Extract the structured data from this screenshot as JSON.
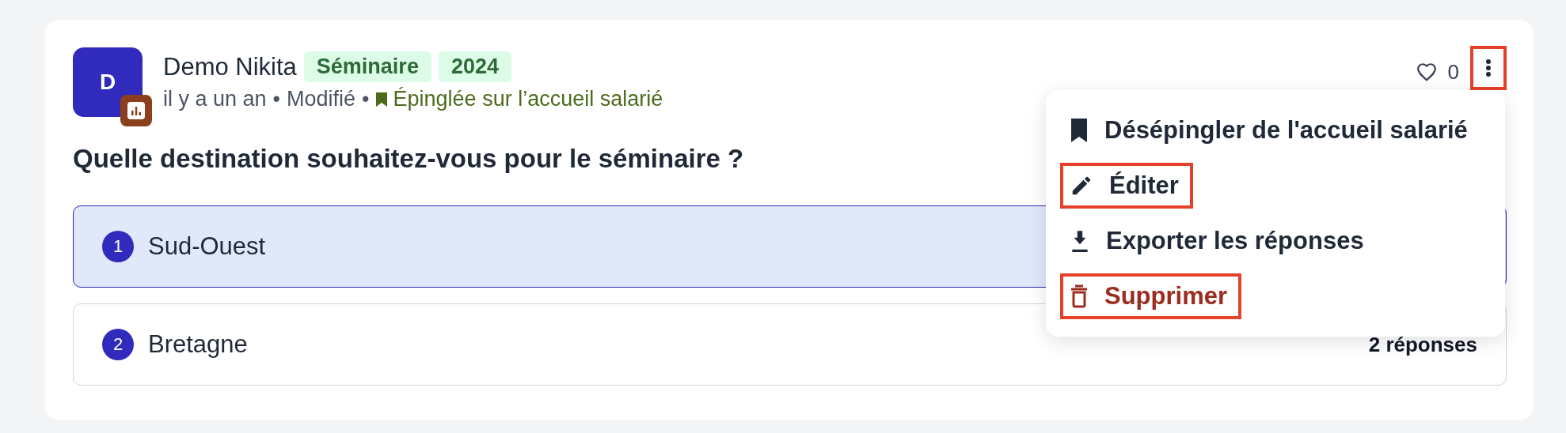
{
  "post": {
    "author_initial": "D",
    "author": "Demo Nikita",
    "tags": [
      {
        "label": "Séminaire"
      },
      {
        "label": "2024"
      }
    ],
    "time": "il y a un an",
    "edited": "Modifié",
    "separator": "•",
    "pinned": "Épinglée sur l’accueil salarié",
    "likes": "0",
    "liked": false,
    "more_highlighted": true,
    "question": "Quelle destination souhaitez-vous pour le séminaire ?",
    "options": [
      {
        "number": "1",
        "label": "Sud-Ouest",
        "selected": true
      },
      {
        "number": "2",
        "label": "Bretagne",
        "selected": false,
        "responses": "2 réponses"
      }
    ]
  },
  "menu": {
    "items": [
      {
        "kind": "unpin",
        "label": "Désépingler de l'accueil salarié",
        "highlighted": false
      },
      {
        "kind": "edit",
        "label": "Éditer",
        "highlighted": true
      },
      {
        "kind": "export",
        "label": "Exporter les réponses",
        "highlighted": false
      },
      {
        "kind": "delete",
        "label": "Supprimer",
        "highlighted": true
      }
    ]
  }
}
